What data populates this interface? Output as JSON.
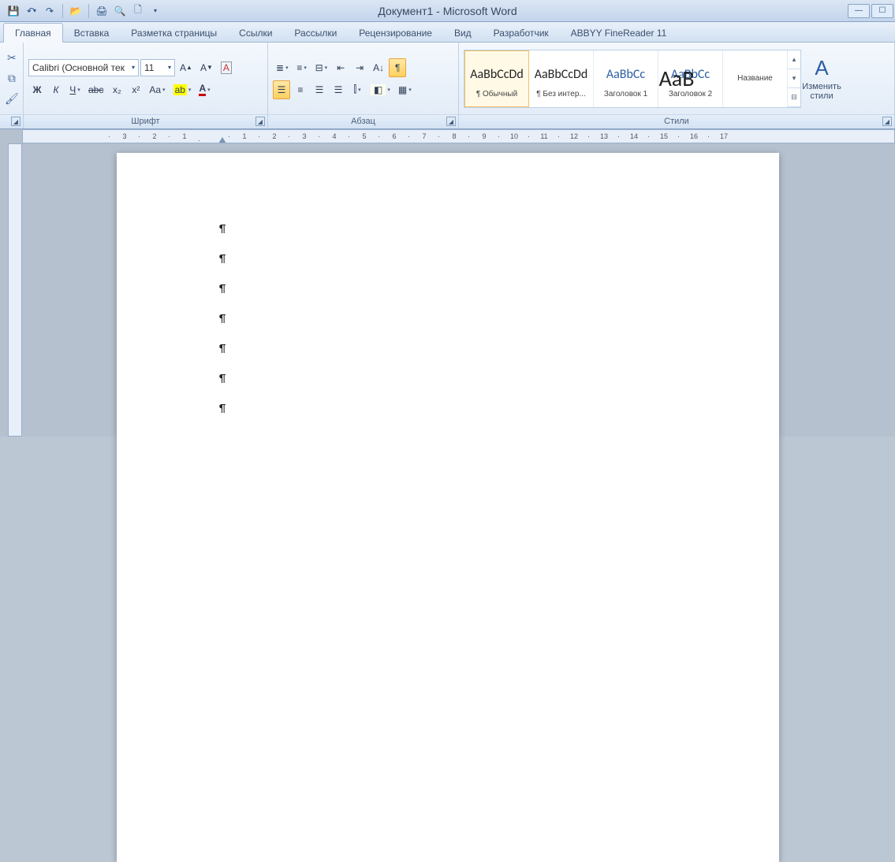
{
  "window": {
    "title": "Документ1 - Microsoft Word"
  },
  "qat": {
    "save": "💾",
    "undo": "↶",
    "redo": "↷",
    "open": "📂",
    "quickprint": "🖨",
    "preview": "🔍",
    "new": "🗋"
  },
  "tabs": [
    {
      "id": "home",
      "label": "Главная",
      "active": true
    },
    {
      "id": "insert",
      "label": "Вставка"
    },
    {
      "id": "layout",
      "label": "Разметка страницы"
    },
    {
      "id": "refs",
      "label": "Ссылки"
    },
    {
      "id": "mail",
      "label": "Рассылки"
    },
    {
      "id": "review",
      "label": "Рецензирование"
    },
    {
      "id": "view",
      "label": "Вид"
    },
    {
      "id": "dev",
      "label": "Разработчик"
    },
    {
      "id": "abbyy",
      "label": "ABBYY FineReader 11"
    }
  ],
  "groups": {
    "font": {
      "label": "Шрифт",
      "name_value": "Calibri (Основной тек",
      "size_value": "11",
      "bold": "Ж",
      "italic": "К",
      "underline": "Ч",
      "strike": "abc",
      "sub": "x₂",
      "sup": "x²",
      "case": "Aa",
      "clear": "⌫",
      "grow": "A▲",
      "shrink": "A▼"
    },
    "paragraph": {
      "label": "Абзац"
    },
    "styles": {
      "label": "Стили",
      "items": [
        {
          "preview": "AaBbCcDd",
          "cls": "",
          "name": "¶ Обычный",
          "sel": true
        },
        {
          "preview": "AaBbCcDd",
          "cls": "",
          "name": "¶ Без интер..."
        },
        {
          "preview": "AaBbCc",
          "cls": "h1",
          "name": "Заголовок 1"
        },
        {
          "preview": "AaBbCc",
          "cls": "h2",
          "name": "Заголовок 2"
        },
        {
          "preview": "АаВ",
          "cls": "title",
          "name": "Название"
        }
      ],
      "change_btn": "Изменить\nстили"
    }
  },
  "ruler": {
    "marks": [
      "3",
      "2",
      "1",
      "",
      "1",
      "2",
      "3",
      "4",
      "5",
      "6",
      "7",
      "8",
      "9",
      "10",
      "11",
      "12",
      "13",
      "14",
      "15",
      "16",
      "17"
    ]
  },
  "document": {
    "pilcrow": "¶",
    "paragraphs": 7
  }
}
